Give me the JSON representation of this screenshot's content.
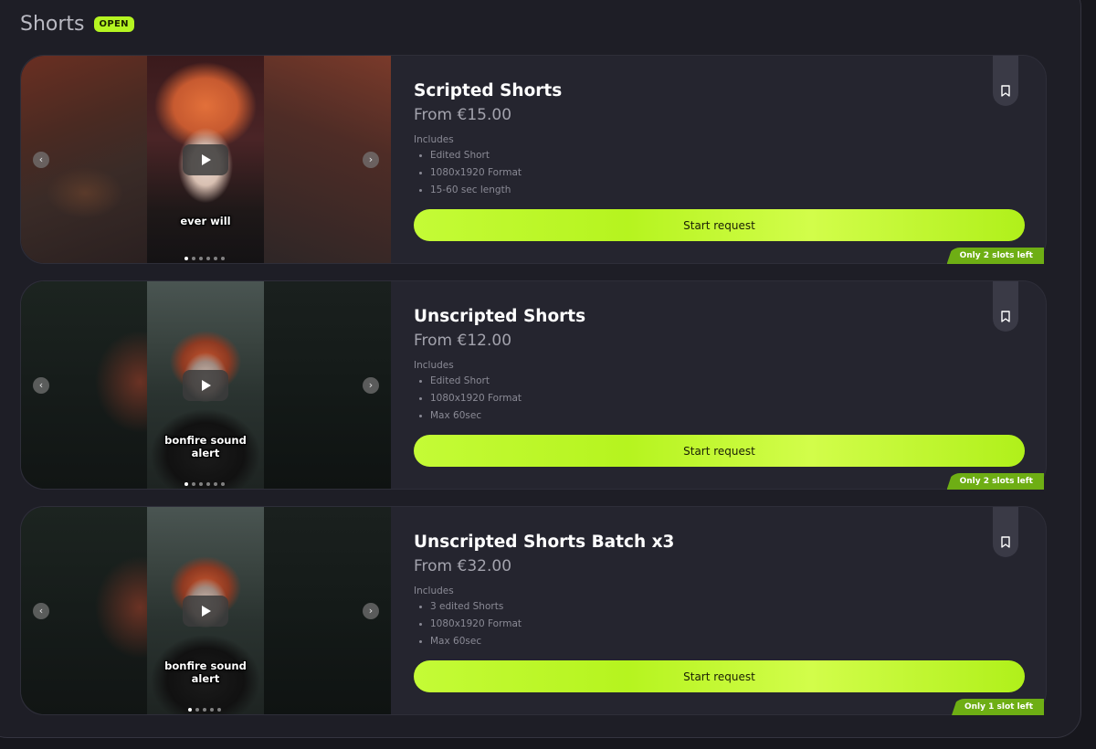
{
  "section": {
    "title": "Shorts",
    "status_badge": "OPEN"
  },
  "cards": [
    {
      "title": "Scripted Shorts",
      "price": "From €15.00",
      "includes_label": "Includes",
      "includes": [
        "Edited Short",
        "1080x1920 Format",
        "15-60 sec length"
      ],
      "cta": "Start request",
      "slots": "Only 2 slots left",
      "caption": "ever will",
      "carousel": {
        "total_slides": 6,
        "active_slide": 1
      }
    },
    {
      "title": "Unscripted Shorts",
      "price": "From €12.00",
      "includes_label": "Includes",
      "includes": [
        "Edited Short",
        "1080x1920 Format",
        "Max 60sec"
      ],
      "cta": "Start request",
      "slots": "Only 2 slots left",
      "caption": "bonfire sound alert",
      "carousel": {
        "total_slides": 6,
        "active_slide": 1
      }
    },
    {
      "title": "Unscripted Shorts Batch x3",
      "price": "From €32.00",
      "includes_label": "Includes",
      "includes": [
        "3 edited Shorts",
        "1080x1920 Format",
        "Max 60sec"
      ],
      "cta": "Start request",
      "slots": "Only 1 slot left",
      "caption": "bonfire sound alert",
      "carousel": {
        "total_slides": 5,
        "active_slide": 1
      }
    }
  ],
  "icons": {
    "play": "play-icon",
    "bookmark": "bookmark-icon",
    "prev": "chevron-left-icon",
    "next": "chevron-right-icon"
  },
  "colors": {
    "accent": "#b5f521",
    "slots_badge": "#6eae14",
    "card_bg": "#25252f",
    "page_bg": "#1e1e26"
  }
}
